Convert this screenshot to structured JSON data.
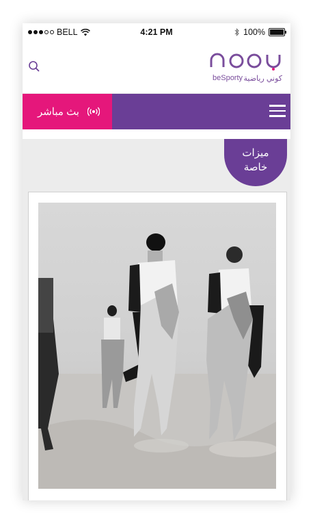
{
  "status_bar": {
    "carrier": "BELL",
    "time": "4:21 PM",
    "battery": "100%"
  },
  "header": {
    "logo_name_en": "beSporty",
    "logo_name_ar": "كوني رياضية"
  },
  "nav": {
    "live_label": "بث مباشر"
  },
  "badge": {
    "line1": "ميزات",
    "line2": "خاصة"
  },
  "colors": {
    "brand_purple": "#6a3e96",
    "live_pink": "#e5177b"
  }
}
